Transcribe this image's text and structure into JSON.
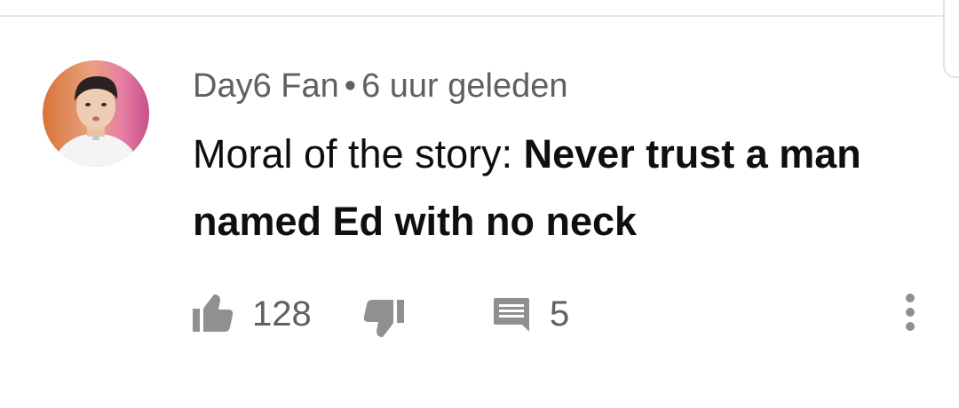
{
  "comment": {
    "author": "Day6 Fan",
    "separator": "•",
    "timestamp": "6 uur geleden",
    "text_plain": "Moral of the story: ",
    "text_bold": "Never trust a man named Ed with no neck"
  },
  "actions": {
    "like_count": "128",
    "reply_count": "5"
  },
  "icons": {
    "like": "thumbs-up-icon",
    "dislike": "thumbs-down-icon",
    "reply": "comment-icon",
    "menu": "more-vert-icon"
  },
  "colors": {
    "secondary_text": "#606060",
    "primary_text": "#0f0f0f",
    "icon": "#909090"
  }
}
